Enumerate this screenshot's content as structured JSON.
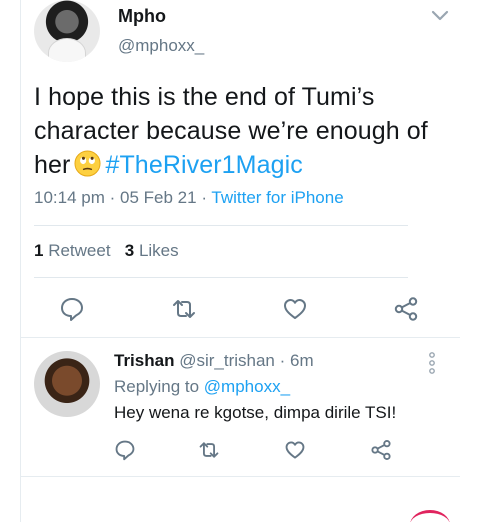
{
  "tweet": {
    "author_name": "Mpho",
    "author_handle": "@mphoxx_",
    "text_before": "I hope this is the end of Tumi’s character because we’re enough of her",
    "hashtag": "#TheRiver1Magic",
    "time": "10:14 pm",
    "date": "05 Feb 21",
    "source": "Twitter for iPhone",
    "retweet_count": "1",
    "retweet_label": "Retweet",
    "like_count": "3",
    "like_label": "Likes"
  },
  "reply": {
    "author_name": "Trishan",
    "author_handle": "@sir_trishan",
    "age": "6m",
    "replying_label": "Replying to",
    "replying_handle": "@mphoxx_",
    "text": "Hey wena re kgotse, dimpa dirile TSI!"
  },
  "colors": {
    "accent": "#1da1f2",
    "muted": "#657786",
    "text": "#14171a"
  },
  "icons": [
    "chevron-down-icon",
    "reply-icon",
    "retweet-icon",
    "like-icon",
    "share-icon",
    "more-options-icon",
    "emoji-eye-roll-icon"
  ]
}
